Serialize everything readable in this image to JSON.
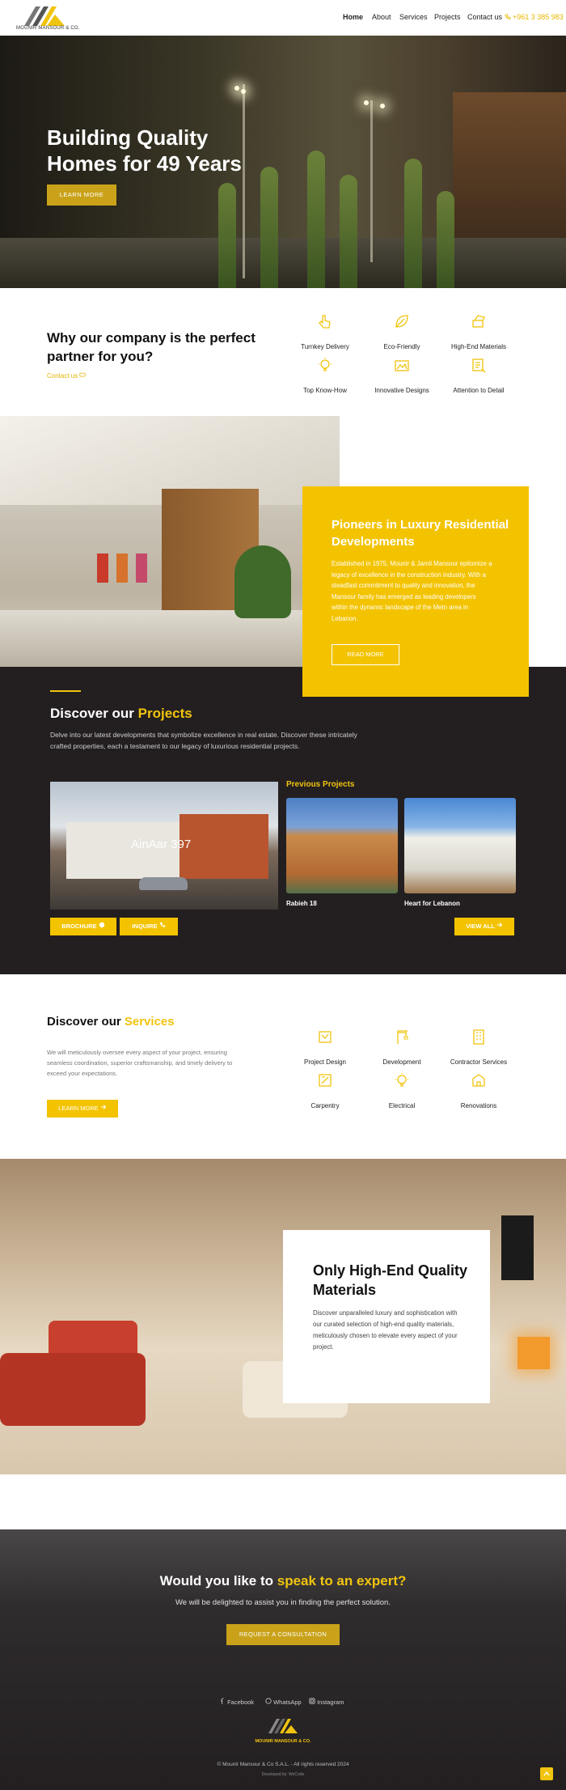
{
  "header": {
    "logo_text": "MOUNIR MANSOUR & CO.",
    "nav": [
      "Home",
      "About",
      "Services",
      "Projects",
      "Contact us"
    ],
    "phone": "+961 3 385 983"
  },
  "hero": {
    "title_line1": "Building Quality",
    "title_line2": "Homes for 49 Years",
    "button": "LEARN MORE"
  },
  "why": {
    "title": "Why our company is the perfect partner for you?",
    "link": "Contact us",
    "features": [
      {
        "label": "Turnkey Delivery",
        "icon": "hand-pointer-icon"
      },
      {
        "label": "Eco-Friendly",
        "icon": "leaf-icon"
      },
      {
        "label": "High-End Materials",
        "icon": "materials-icon"
      },
      {
        "label": "Top Know-How",
        "icon": "lightbulb-icon"
      },
      {
        "label": "Innovative Designs",
        "icon": "design-icon"
      },
      {
        "label": "Attention to Detail",
        "icon": "detail-icon"
      }
    ]
  },
  "pioneers": {
    "title": "Pioneers in Luxury Residential Developments",
    "text": "Established in 1975, Mounir & Jamil Mansour epitomize a legacy of excellence in the construction industry. With a steadfast commitment to quality and innovation, the Mansour family has emerged as leading developers within the dynamic landscape of the Metn area in Lebanon.",
    "button": "READ MORE"
  },
  "projects": {
    "title_plain": "Discover our ",
    "title_accent": "Projects",
    "text": "Delve into our latest developments that symbolize excellence in real estate. Discover these intricately crafted properties, each a testament to our legacy of luxurious residential projects.",
    "main_label": "AinAar 397",
    "previous_title": "Previous Projects",
    "previous": [
      "Rabieh 18",
      "Heart for Lebanon"
    ],
    "buttons": {
      "brochure": "BROCHURE",
      "inquire": "INQUIRE",
      "view_all": "VIEW ALL"
    }
  },
  "services": {
    "title_plain": "Discover our ",
    "title_accent": "Services",
    "text": "We will meticulously oversee every aspect of your project, ensuring seamless coordination, superior craftsmanship, and timely delivery to exceed your expectations.",
    "button": "LEARN MORE",
    "items": [
      {
        "label": "Project Design",
        "icon": "project-design-icon"
      },
      {
        "label": "Development",
        "icon": "crane-icon"
      },
      {
        "label": "Contractor Services",
        "icon": "building-icon"
      },
      {
        "label": "Carpentry",
        "icon": "carpentry-icon"
      },
      {
        "label": "Electrical",
        "icon": "electrical-icon"
      },
      {
        "label": "Renovations",
        "icon": "renovation-icon"
      }
    ]
  },
  "materials": {
    "title": "Only High-End Quality Materials",
    "text": "Discover unparalleled luxury and sophistication with our curated selection of high-end quality materials, meticulously chosen to elevate every aspect of your project."
  },
  "cta": {
    "title_plain": "Would you like to ",
    "title_accent": "speak to an expert?",
    "subtitle": "We will be delighted to assist you in finding the perfect solution.",
    "button": "REQUEST A CONSULTATION"
  },
  "footer": {
    "social": [
      "Facebook",
      "WhatsApp",
      "Instagram"
    ],
    "logo_text": "MOUNIR MANSOUR & CO.",
    "copyright": "© Mounir Mansour & Co S.A.L. - All rights reserved 2024",
    "developed": "Developed by: WeCode"
  },
  "colors": {
    "accent": "#f1c40f",
    "dark": "#231f20",
    "button_gold": "#c9a21a"
  }
}
